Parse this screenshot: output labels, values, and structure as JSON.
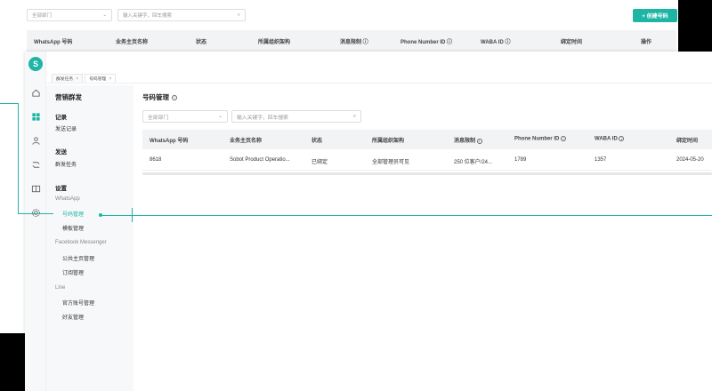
{
  "background_window": {
    "dept_select": "全部部门",
    "search_placeholder": "输入关键字，回车搜索",
    "create_button": "+ 创建号码",
    "columns": [
      "WhatsApp 号码",
      "业务主页名称",
      "状态",
      "所属组织架构",
      "消息限制 ⓘ",
      "Phone Number ID ⓘ",
      "WABA ID ⓘ",
      "绑定时间",
      "操作"
    ]
  },
  "logo_letter": "S",
  "tabs": [
    {
      "label": "群发任务"
    },
    {
      "label": "号码管理"
    }
  ],
  "sidebar": {
    "title": "营销群发",
    "groups": {
      "records": {
        "label": "记录",
        "items": [
          "发送记录"
        ]
      },
      "send": {
        "label": "发送",
        "items": [
          "群发任务"
        ]
      },
      "settings": {
        "label": "设置"
      }
    },
    "whatsapp": {
      "label": "WhatsApp",
      "items": [
        "号码管理",
        "模板管理"
      ]
    },
    "facebook": {
      "label": "Facebook Messenger",
      "items": [
        "公共主页管理",
        "订阅管理"
      ]
    },
    "line": {
      "label": "Line",
      "items": [
        "官方账号管理",
        "好友管理"
      ]
    }
  },
  "main": {
    "title": "号码管理",
    "dept_select": "全部部门",
    "search_placeholder": "输入关键字，回车搜索",
    "columns": [
      "WhatsApp 号码",
      "业务主页名称",
      "状态",
      "所属组织架构",
      "消息限制",
      "Phone Number ID",
      "WABA ID",
      "绑定时间"
    ],
    "rows": [
      {
        "number": "8618",
        "page_name": "Sobot Product Operatio...",
        "status": "已绑定",
        "org": "全部管理员可见",
        "limit": "250 位客户/24...",
        "phone_id": "1789",
        "waba_id": "1357",
        "bind_time": "2024-05-20"
      }
    ]
  },
  "colors": {
    "accent": "#1fb5a5"
  }
}
